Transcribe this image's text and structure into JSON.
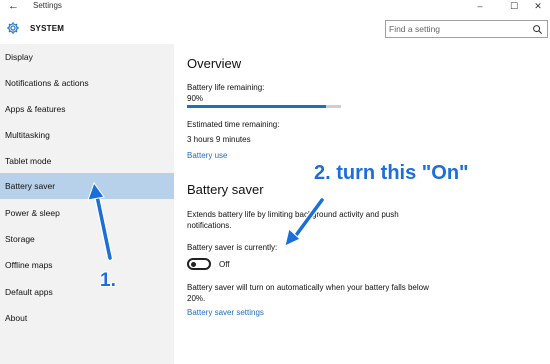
{
  "window": {
    "title": "Settings",
    "back_glyph": "←",
    "minimize_glyph": "–",
    "maximize_glyph": "☐",
    "close_glyph": "✕"
  },
  "header": {
    "icon": "gear-icon",
    "section_title": "SYSTEM",
    "search_placeholder": "Find a setting",
    "search_icon": "search-icon"
  },
  "sidebar": {
    "items": [
      {
        "label": "Display",
        "selected": false
      },
      {
        "label": "Notifications & actions",
        "selected": false
      },
      {
        "label": "Apps & features",
        "selected": false
      },
      {
        "label": "Multitasking",
        "selected": false
      },
      {
        "label": "Tablet mode",
        "selected": false
      },
      {
        "label": "Battery saver",
        "selected": true
      },
      {
        "label": "Power & sleep",
        "selected": false
      },
      {
        "label": "Storage",
        "selected": false
      },
      {
        "label": "Offline maps",
        "selected": false
      },
      {
        "label": "Default apps",
        "selected": false
      },
      {
        "label": "About",
        "selected": false
      }
    ]
  },
  "overview": {
    "heading": "Overview",
    "battery_life_label": "Battery life remaining:",
    "battery_life_value": "90%",
    "battery_life_fraction": 0.9,
    "estimated_label": "Estimated time remaining:",
    "estimated_value": "3 hours 9 minutes",
    "battery_use_link": "Battery use"
  },
  "battery_saver": {
    "heading": "Battery saver",
    "description": "Extends battery life by limiting background activity and push notifications.",
    "currently_label": "Battery saver is currently:",
    "toggle_state": "Off",
    "auto_text": "Battery saver will turn on automatically when your battery falls below 20%.",
    "settings_link": "Battery saver settings"
  },
  "annotations": {
    "step1": "1.",
    "step2": "2. turn this \"On\""
  },
  "colors": {
    "accent": "#1e6fc2",
    "sidebar_bg": "#f2f2f2",
    "selected_bg": "#b7d1ea",
    "annotation": "#1c6ed8"
  }
}
